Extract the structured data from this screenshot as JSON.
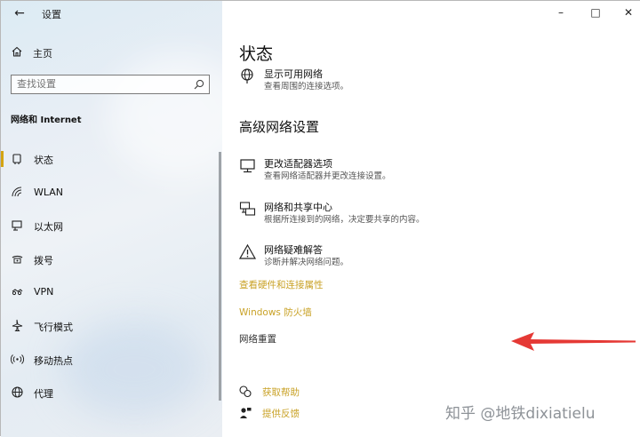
{
  "window": {
    "title": "设置"
  },
  "left": {
    "home_label": "主页",
    "search_placeholder": "查找设置",
    "section_title": "网络和 Internet",
    "nav_items": [
      {
        "label": "状态",
        "icon": "status-icon"
      },
      {
        "label": "WLAN",
        "icon": "wifi-icon"
      },
      {
        "label": "以太网",
        "icon": "ethernet-icon"
      },
      {
        "label": "拨号",
        "icon": "dialup-icon"
      },
      {
        "label": "VPN",
        "icon": "vpn-icon"
      },
      {
        "label": "飞行模式",
        "icon": "airplane-icon"
      },
      {
        "label": "移动热点",
        "icon": "hotspot-icon"
      },
      {
        "label": "代理",
        "icon": "globe-icon"
      }
    ],
    "active_index": 0
  },
  "main": {
    "title": "状态",
    "show_networks": {
      "title": "显示可用网络",
      "desc": "查看周围的连接选项。"
    },
    "advanced_title": "高级网络设置",
    "options": [
      {
        "title": "更改适配器选项",
        "desc": "查看网络适配器并更改连接设置。"
      },
      {
        "title": "网络和共享中心",
        "desc": "根据所连接到的网络，决定要共享的内容。"
      },
      {
        "title": "网络疑难解答",
        "desc": "诊断并解决网络问题。"
      }
    ],
    "links": {
      "hardware": "查看硬件和连接属性",
      "firewall": "Windows 防火墙",
      "reset": "网络重置"
    },
    "help": {
      "get_help": "获取帮助",
      "feedback": "提供反馈"
    }
  },
  "watermark": "知乎 @地铁dixiatielu",
  "colors": {
    "accent": "#c9a227",
    "active_bar": "#d4a412",
    "arrow": "#e53935"
  }
}
